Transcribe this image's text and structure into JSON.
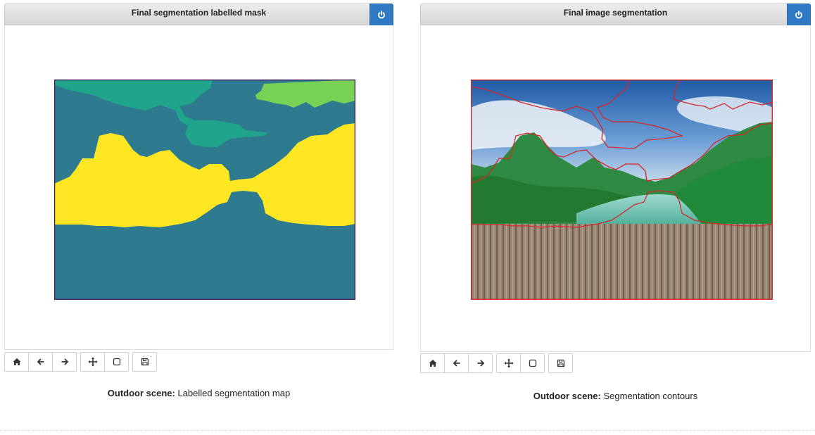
{
  "figures": [
    {
      "title": "Final segmentation labelled mask",
      "close_icon": "power-icon",
      "toolbar_icons": [
        "home-icon",
        "back-arrow-icon",
        "forward-arrow-icon",
        "pan-icon",
        "zoom-rect-icon",
        "save-icon"
      ],
      "caption_bold": "Outdoor scene:",
      "caption_text": " Labelled segmentation map",
      "colors": {
        "background_region": "#2e7a8e",
        "sky_region": "#21a48c",
        "light_region": "#77d154",
        "yellow_region": "#fde725",
        "border": "#44155a"
      }
    },
    {
      "title": "Final image segmentation",
      "close_icon": "power-icon",
      "toolbar_icons": [
        "home-icon",
        "back-arrow-icon",
        "forward-arrow-icon",
        "pan-icon",
        "zoom-rect-icon",
        "save-icon"
      ],
      "caption_bold": "Outdoor scene:",
      "caption_text": " Segmentation contours",
      "colors": {
        "contour": "#d62728",
        "sky": "#2f6fb8",
        "mountains": "#2f8a44",
        "water": "#6ec7bf",
        "deck": "#8f7a66"
      }
    }
  ]
}
